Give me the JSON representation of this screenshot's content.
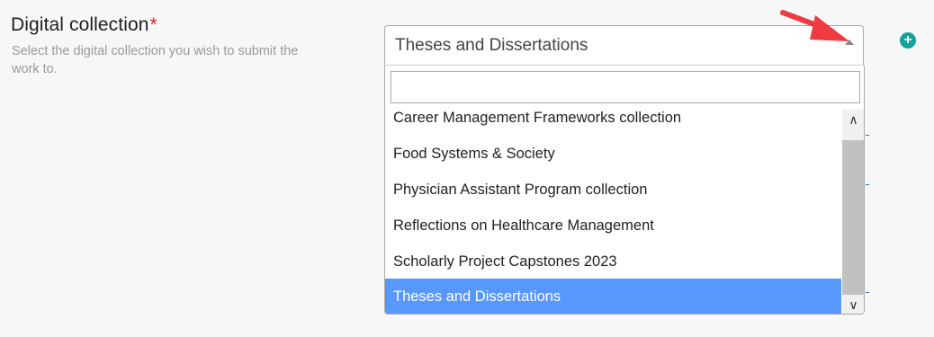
{
  "field": {
    "label": "Digital collection",
    "required_mark": "*",
    "help": "Select the digital collection you wish to submit the work to."
  },
  "select": {
    "value": "Theses and Dissertations",
    "arrow_icon": "triangle-up-icon"
  },
  "dropdown": {
    "search_value": "",
    "options": [
      "Career Management Frameworks collection",
      "Food Systems & Society",
      "Physician Assistant Program collection",
      "Reflections on Healthcare Management",
      "Scholarly Project Capstones 2023",
      "Theses and Dissertations"
    ],
    "highlighted_index": 5,
    "scroll_up_glyph": "∧",
    "scroll_down_glyph": "∨"
  },
  "add_button": {
    "glyph": "+",
    "icon": "plus-circle-icon"
  },
  "annotation": {
    "icon": "red-arrow-icon"
  },
  "colors": {
    "highlight": "#5897fb",
    "required": "#d9232b",
    "add_button": "#12a39a",
    "annotation_arrow": "#f03a3f"
  }
}
